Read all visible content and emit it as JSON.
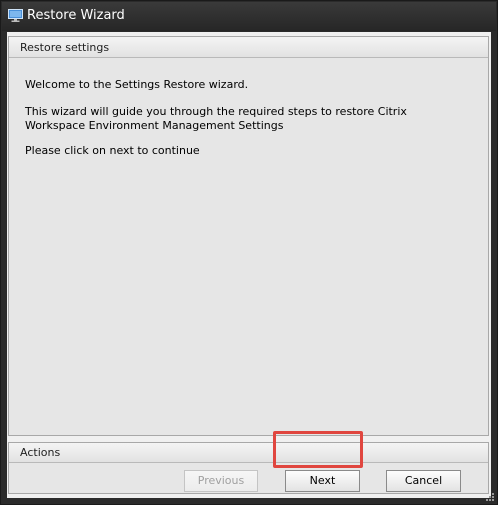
{
  "window": {
    "title": "Restore Wizard",
    "icon": "monitor-icon"
  },
  "restore_group": {
    "header": "Restore settings",
    "messages": [
      "Welcome to the Settings Restore wizard.",
      "This wizard will guide you through the required steps to restore Citrix Workspace Environment Management Settings",
      "Please click on next to continue"
    ]
  },
  "actions_group": {
    "header": "Actions",
    "previous_label": "Previous",
    "previous_enabled": false,
    "next_label": "Next",
    "next_highlighted": true,
    "cancel_label": "Cancel"
  },
  "colors": {
    "titlebar": "#262626",
    "client_background": "#f0f0f0",
    "highlight_border": "#e0463f"
  }
}
